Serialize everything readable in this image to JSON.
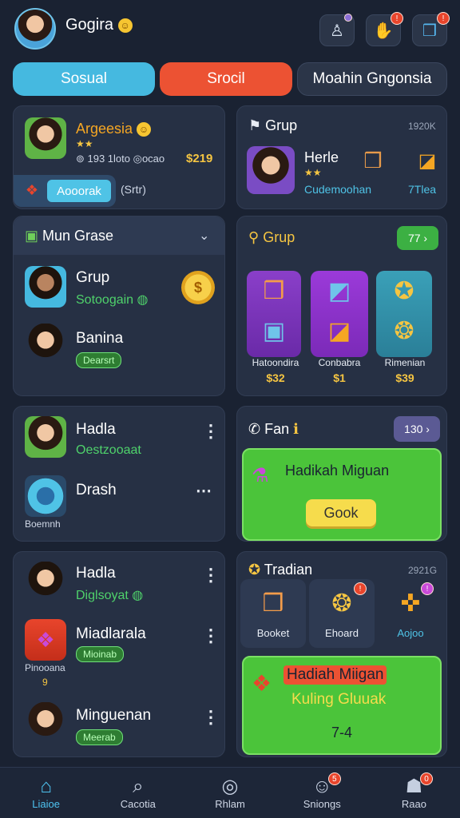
{
  "header": {
    "username": "Gogira",
    "emoji": "☺",
    "buttons": [
      {
        "icon": "user-icon",
        "glyph": "♙",
        "badge": ""
      },
      {
        "icon": "hand-icon",
        "glyph": "✋",
        "badge": "!"
      },
      {
        "icon": "book-icon",
        "glyph": "❒",
        "badge": "!"
      }
    ]
  },
  "tabs": [
    {
      "label": "Sosual",
      "color": "#45b9e0"
    },
    {
      "label": "Srocil",
      "color": "#ec5233"
    },
    {
      "label": "Moahin Gngonsia",
      "color": "#2b3548"
    }
  ],
  "card_profile": {
    "name": "Argeesia",
    "stars": "★★",
    "stats": "⊚ 193  1loto  ◎ocao",
    "amount": "$219",
    "button": "Aooorak",
    "side_text": "(Srtr)"
  },
  "card_grup_top": {
    "title": "Grup",
    "count": "1920K",
    "name": "Herle",
    "stars": "★★",
    "sub": "Cudemoohan",
    "right_sub": "7Tlea"
  },
  "card_list1": {
    "title": "Mun Grase",
    "items": [
      {
        "name": "Grup",
        "sub": "Sotoogain"
      },
      {
        "name": "Banina",
        "sub": "Dearsrt"
      }
    ]
  },
  "card_grup_shop": {
    "title": "Grup",
    "counter": "77 ›",
    "items": [
      {
        "label": "Hatoondira",
        "price": "$32"
      },
      {
        "label": "Conbabra",
        "price": "$1"
      },
      {
        "label": "Rimenian",
        "price": "$39"
      }
    ]
  },
  "card_list2": {
    "items": [
      {
        "name": "Hadla",
        "sub": "Oestzooaat"
      },
      {
        "name": "Drash",
        "sub": "Boemnh"
      }
    ]
  },
  "card_fan": {
    "title": "Fan",
    "counter": "130 ›",
    "panel_title": "Hadikah Miguan",
    "button": "Gook"
  },
  "card_list3": {
    "items": [
      {
        "name": "Hadla",
        "sub": "Diglsoyat"
      },
      {
        "name": "Miadlarala",
        "sub": "Mioinab",
        "side": "Pinooana",
        "side2": "9"
      },
      {
        "name": "Minguenan",
        "sub": "Meerab"
      }
    ]
  },
  "card_tradian": {
    "title": "Tradian",
    "count": "2921G",
    "items": [
      {
        "label": "Booket"
      },
      {
        "label": "Ehoard"
      },
      {
        "label": "Aojoo"
      }
    ],
    "panel_title": "Hadiah Miigan",
    "panel_sub": "Kuling Gluuak",
    "panel_value": "7-4"
  },
  "nav": [
    {
      "label": "Liaioe",
      "icon": "home-icon",
      "glyph": "⌂"
    },
    {
      "label": "Cacotia",
      "icon": "search-icon",
      "glyph": "⌕"
    },
    {
      "label": "Rhlam",
      "icon": "compass-icon",
      "glyph": "◎"
    },
    {
      "label": "Sniongs",
      "icon": "chat-icon",
      "glyph": "☺",
      "badge": "5"
    },
    {
      "label": "Raao",
      "icon": "profile-icon",
      "glyph": "☗",
      "badge": "0"
    }
  ]
}
